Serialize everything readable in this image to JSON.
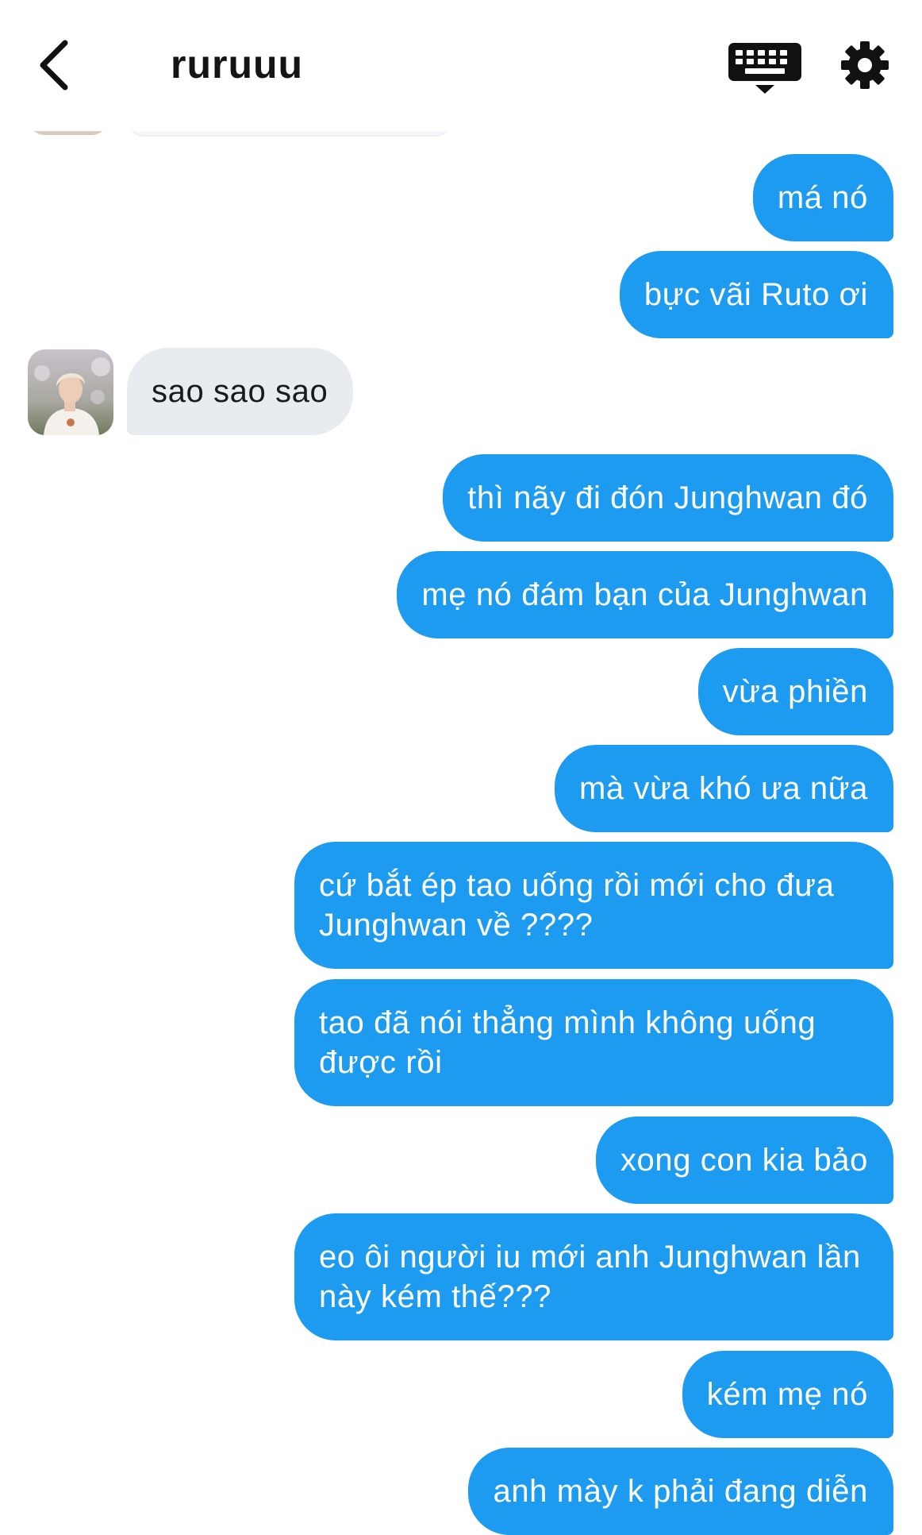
{
  "header": {
    "title": "ruruuu",
    "back_icon": "chevron-left-icon",
    "keyboard_icon": "keyboard-icon",
    "settings_icon": "gear-icon"
  },
  "colors": {
    "outgoing_bubble": "#1d9bf0",
    "incoming_bubble": "#e8ecf0",
    "background": "#ffffff"
  },
  "messages": [
    {
      "side": "out",
      "text": "má nó"
    },
    {
      "side": "out",
      "text": "bực vãi Ruto ơi"
    },
    {
      "side": "in",
      "text": "sao sao sao"
    },
    {
      "side": "out",
      "text": "thì nãy đi đón Junghwan đó"
    },
    {
      "side": "out",
      "text": "mẹ nó đám bạn của Junghwan"
    },
    {
      "side": "out",
      "text": "vừa phiền"
    },
    {
      "side": "out",
      "text": "mà vừa khó ưa nữa"
    },
    {
      "side": "out",
      "text": "cứ bắt ép tao uống rồi mới cho đưa Junghwan về ????"
    },
    {
      "side": "out",
      "text": "tao đã nói thẳng mình không uống được rồi"
    },
    {
      "side": "out",
      "text": "xong con kia bảo"
    },
    {
      "side": "out",
      "text": "eo ôi người iu mới anh Junghwan lần này kém thế???"
    },
    {
      "side": "out",
      "text": "kém mẹ nó"
    },
    {
      "side": "out",
      "text": "anh mày k phải đang diễn"
    }
  ]
}
